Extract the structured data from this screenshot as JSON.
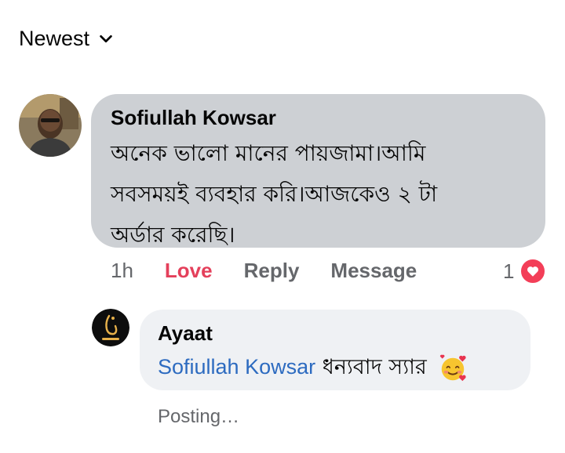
{
  "sort": {
    "label": "Newest"
  },
  "comment": {
    "author": "Sofiullah Kowsar",
    "lines": [
      "অনেক ভালো মানের পায়জামা।আমি",
      "সবসময়ই ব্যবহার করি।আজকেও ২ টা",
      "অর্ডার করেছি।"
    ],
    "time": "1h",
    "love_label": "Love",
    "reply_label": "Reply",
    "message_label": "Message",
    "reaction_count": "1",
    "reaction_icon": "heart-icon",
    "reaction_color": "#f33e58"
  },
  "reply": {
    "author": "Ayaat",
    "mention": "Sofiullah Kowsar",
    "text": "ধন্যবাদ স্যার",
    "emoji": "smiling-face-with-hearts",
    "status": "Posting…",
    "logo_text": "Ayaat"
  },
  "colors": {
    "comment_bubble": "#cdd0d4",
    "reply_bubble": "#eff1f4",
    "mention": "#2d6bc0",
    "love": "#e4405b",
    "secondary_text": "#65676b"
  }
}
